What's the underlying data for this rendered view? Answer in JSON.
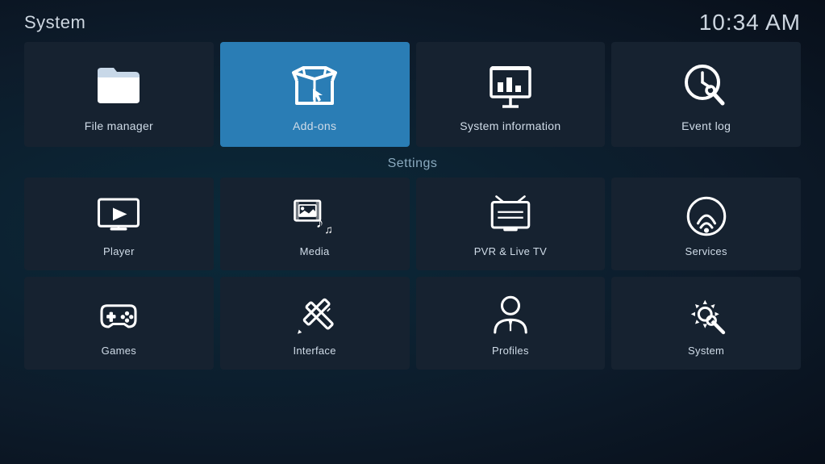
{
  "header": {
    "title": "System",
    "time": "10:34 AM"
  },
  "top_tiles": [
    {
      "id": "file-manager",
      "label": "File manager",
      "icon": "folder"
    },
    {
      "id": "add-ons",
      "label": "Add-ons",
      "icon": "box",
      "active": true
    },
    {
      "id": "system-information",
      "label": "System information",
      "icon": "presentation"
    },
    {
      "id": "event-log",
      "label": "Event log",
      "icon": "clock-search"
    }
  ],
  "settings": {
    "heading": "Settings",
    "tiles": [
      {
        "id": "player",
        "label": "Player",
        "icon": "monitor-play"
      },
      {
        "id": "media",
        "label": "Media",
        "icon": "media"
      },
      {
        "id": "pvr-live-tv",
        "label": "PVR & Live TV",
        "icon": "tv"
      },
      {
        "id": "services",
        "label": "Services",
        "icon": "wifi-circle"
      },
      {
        "id": "games",
        "label": "Games",
        "icon": "gamepad"
      },
      {
        "id": "interface",
        "label": "Interface",
        "icon": "pencil-ruler"
      },
      {
        "id": "profiles",
        "label": "Profiles",
        "icon": "person"
      },
      {
        "id": "system",
        "label": "System",
        "icon": "gear-wrench"
      }
    ]
  }
}
